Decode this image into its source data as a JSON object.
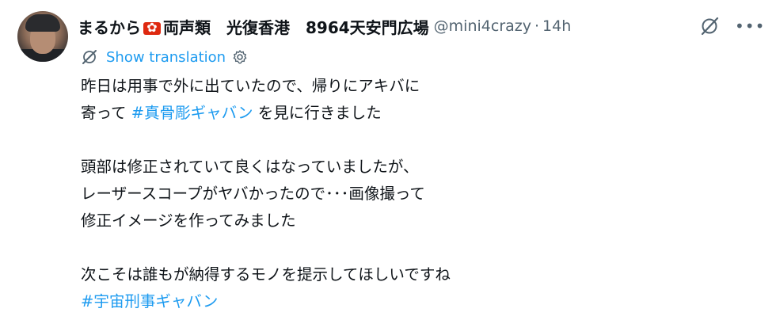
{
  "author": {
    "name_prefix": "まるから",
    "name_suffix": "両声類　光復香港　8964天安門広場",
    "handle": "@mini4crazy",
    "separator": "·",
    "time": "14h"
  },
  "translation": {
    "label": "Show translation"
  },
  "icons": {
    "flag": "hong-kong-flag",
    "grok": "grok-icon",
    "more": "more-icon",
    "translate": "translate-icon",
    "settings": "gear-icon"
  },
  "tweet": {
    "line1": "昨日は用事で外に出ていたので、帰りにアキバに",
    "line2_pre": "寄って ",
    "line2_tag": "#真骨彫ギャバン",
    "line2_post": " を見に行きました",
    "line4": "頭部は修正されていて良くはなっていましたが、",
    "line5": "レーザースコープがヤバかったので･･･画像撮って",
    "line6": "修正イメージを作ってみました",
    "line8": "次こそは誰もが納得するモノを提示してほしいですね",
    "line9_tag": "#宇宙刑事ギャバン"
  },
  "colors": {
    "link": "#1d9bf0",
    "text": "#0f1419",
    "muted": "#536471"
  }
}
